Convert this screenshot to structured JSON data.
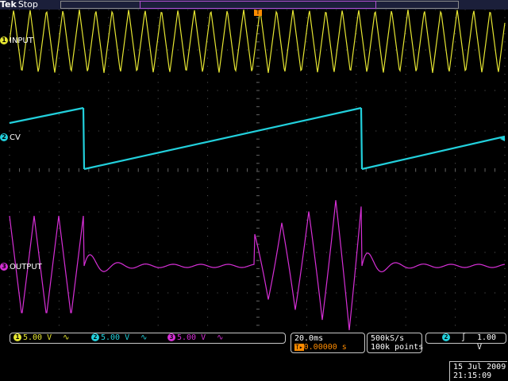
{
  "status": {
    "brand": "Tek",
    "acq_state": "Stop"
  },
  "channels": [
    {
      "id": "1",
      "name": "INPUT",
      "color": "#e6e632",
      "scale": "5.00 V",
      "coupling": "∿"
    },
    {
      "id": "2",
      "name": "CV",
      "color": "#22d0dc",
      "scale": "5.00 V",
      "coupling": "∿"
    },
    {
      "id": "3",
      "name": "OUTPUT",
      "color": "#d62fd6",
      "scale": "5.00 V",
      "coupling": "∿"
    }
  ],
  "timebase": {
    "scale": "20.0ms",
    "trigger_position": "0.00000 s",
    "trigger_icon": "T▸"
  },
  "acquisition": {
    "sample_rate": "500kS/s",
    "record_length": "100k points"
  },
  "trigger": {
    "source": "2",
    "slope_icon": "rising-edge-icon",
    "slope_glyph": "∫",
    "level": "1.00 V"
  },
  "clock": {
    "date": "15 Jul  2009",
    "time": "21:15:09"
  },
  "colors": {
    "ch1": "#e6e632",
    "ch2": "#22d0dc",
    "ch3": "#d62fd6",
    "grid": "#606060"
  }
}
